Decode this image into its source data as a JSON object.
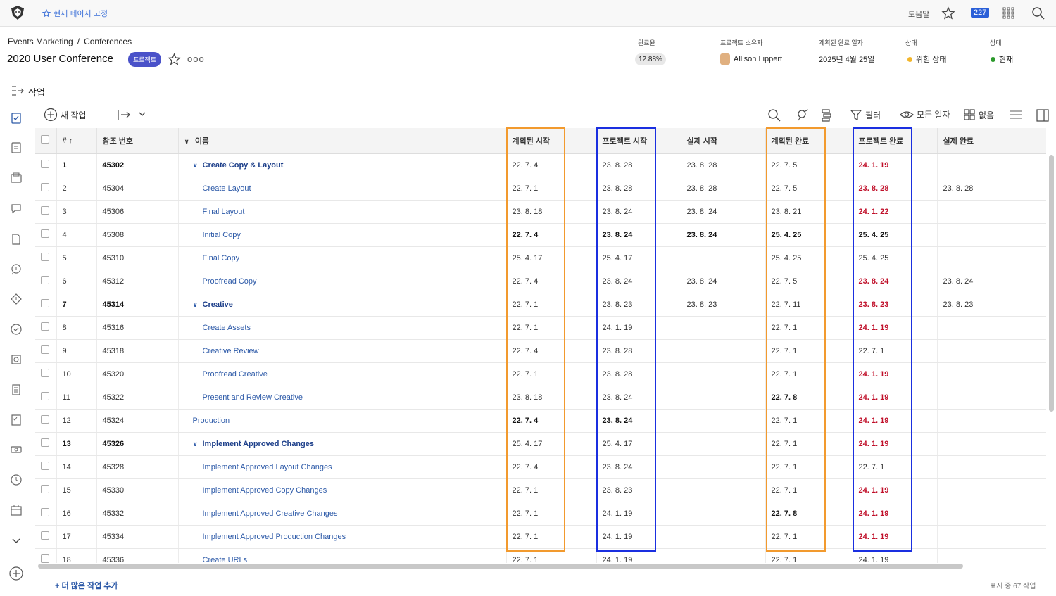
{
  "topbar": {
    "pin_label": "현재 페이지 고정",
    "help_label": "도움말",
    "notification_count": "227"
  },
  "project": {
    "breadcrumb": [
      "Events Marketing",
      "/",
      "Conferences"
    ],
    "title": "2020 User Conference",
    "tag": "프로젝트",
    "more": "ooo",
    "meta": [
      {
        "label": "완료율",
        "value": "12.88%"
      },
      {
        "label": "프로젝트 소유자",
        "value": "Allison Lippert"
      },
      {
        "label": "계획된 완료 일자",
        "value": "2025년 4월 25일"
      },
      {
        "label": "상태",
        "value": "위험 상태",
        "color": "#f3b62b"
      },
      {
        "label": "상태",
        "value": "현재",
        "color": "#2c9a2c"
      }
    ]
  },
  "section": {
    "title": "작업"
  },
  "toolbar": {
    "new_task": "새 작업",
    "filter": "필터",
    "all_dates": "모든 일자",
    "group_none": "없음"
  },
  "table": {
    "headers": {
      "num": "#",
      "ref": "참조 번호",
      "name": "이름",
      "planned_start": "계획된 시작",
      "projected_start": "프로젝트 시작",
      "actual_start": "실제 시작",
      "planned_end": "계획된 완료",
      "projected_end": "프로젝트 완료",
      "actual_end": "실제 완료"
    },
    "rows": [
      {
        "num": "1",
        "ref": "45302",
        "name": "Create Copy & Layout",
        "parent": true,
        "level": 0,
        "ps": "22. 7. 4",
        "prs": "23. 8. 28",
        "as": "23. 8. 28",
        "pe": "22. 7. 5",
        "pre": "24. 1. 19",
        "pre_red": true,
        "ae": ""
      },
      {
        "num": "2",
        "ref": "45304",
        "name": "Create Layout",
        "level": 1,
        "ps": "22. 7. 1",
        "prs": "23. 8. 28",
        "as": "23. 8. 28",
        "pe": "22. 7. 5",
        "pre": "23. 8. 28",
        "pre_red": true,
        "ae": "23. 8. 28"
      },
      {
        "num": "3",
        "ref": "45306",
        "name": "Final Layout",
        "level": 1,
        "ps": "23. 8. 18",
        "prs": "23. 8. 24",
        "as": "23. 8. 24",
        "pe": "23. 8. 21",
        "pre": "24. 1. 22",
        "pre_red": true,
        "ae": ""
      },
      {
        "num": "4",
        "ref": "45308",
        "name": "Initial Copy",
        "level": 1,
        "ps": "22. 7. 4",
        "prs": "23. 8. 24",
        "as": "23. 8. 24",
        "pe": "25. 4. 25",
        "pre": "25. 4. 25",
        "bold_dates": true,
        "ae": ""
      },
      {
        "num": "5",
        "ref": "45310",
        "name": "Final Copy",
        "level": 1,
        "ps": "25. 4. 17",
        "prs": "25. 4. 17",
        "as": "",
        "pe": "25. 4. 25",
        "pre": "25. 4. 25",
        "ae": ""
      },
      {
        "num": "6",
        "ref": "45312",
        "name": "Proofread Copy",
        "level": 1,
        "ps": "22. 7. 4",
        "prs": "23. 8. 24",
        "as": "23. 8. 24",
        "pe": "22. 7. 5",
        "pre": "23. 8. 24",
        "pre_red": true,
        "ae": "23. 8. 24"
      },
      {
        "num": "7",
        "ref": "45314",
        "name": "Creative",
        "parent": true,
        "level": 0,
        "ps": "22. 7. 1",
        "prs": "23. 8. 23",
        "as": "23. 8. 23",
        "pe": "22. 7. 11",
        "pre": "23. 8. 23",
        "pre_red": true,
        "ae": "23. 8. 23"
      },
      {
        "num": "8",
        "ref": "45316",
        "name": "Create Assets",
        "level": 1,
        "ps": "22. 7. 1",
        "prs": "24. 1. 19",
        "as": "",
        "pe": "22. 7. 1",
        "pre": "24. 1. 19",
        "pre_red": true,
        "ae": ""
      },
      {
        "num": "9",
        "ref": "45318",
        "name": "Creative Review",
        "level": 1,
        "ps": "22. 7. 4",
        "prs": "23. 8. 28",
        "as": "",
        "pe": "22. 7. 1",
        "pre": "22. 7. 1",
        "ae": ""
      },
      {
        "num": "10",
        "ref": "45320",
        "name": "Proofread Creative",
        "level": 1,
        "ps": "22. 7. 1",
        "prs": "23. 8. 28",
        "as": "",
        "pe": "22. 7. 1",
        "pre": "24. 1. 19",
        "pre_red": true,
        "ae": ""
      },
      {
        "num": "11",
        "ref": "45322",
        "name": "Present and Review Creative",
        "level": 1,
        "ps": "23. 8. 18",
        "prs": "23. 8. 24",
        "as": "",
        "pe": "22. 7. 8",
        "pe_bold": true,
        "pre": "24. 1. 19",
        "pre_red": true,
        "ae": ""
      },
      {
        "num": "12",
        "ref": "45324",
        "name": "Production",
        "level": 0,
        "ps": "22. 7. 4",
        "ps_bold": true,
        "prs": "23. 8. 24",
        "prs_bold": true,
        "as": "",
        "pe": "22. 7. 1",
        "pre": "24. 1. 19",
        "pre_red": true,
        "ae": ""
      },
      {
        "num": "13",
        "ref": "45326",
        "name": "Implement Approved Changes",
        "parent": true,
        "level": 0,
        "ps": "25. 4. 17",
        "prs": "25. 4. 17",
        "as": "",
        "pe": "22. 7. 1",
        "pre": "24. 1. 19",
        "pre_red": true,
        "ae": ""
      },
      {
        "num": "14",
        "ref": "45328",
        "name": "Implement Approved Layout Changes",
        "level": 1,
        "ps": "22. 7. 4",
        "prs": "23. 8. 24",
        "as": "",
        "pe": "22. 7. 1",
        "pre": "22. 7. 1",
        "ae": ""
      },
      {
        "num": "15",
        "ref": "45330",
        "name": "Implement Approved Copy Changes",
        "level": 1,
        "ps": "22. 7. 1",
        "prs": "23. 8. 23",
        "as": "",
        "pe": "22. 7. 1",
        "pre": "24. 1. 19",
        "pre_red": true,
        "ae": ""
      },
      {
        "num": "16",
        "ref": "45332",
        "name": "Implement Approved Creative Changes",
        "level": 1,
        "ps": "22. 7. 1",
        "prs": "24. 1. 19",
        "as": "",
        "pe": "22. 7. 8",
        "pe_bold": true,
        "pre": "24. 1. 19",
        "pre_red": true,
        "ae": ""
      },
      {
        "num": "17",
        "ref": "45334",
        "name": "Implement Approved Production Changes",
        "level": 1,
        "ps": "22. 7. 1",
        "prs": "24. 1. 19",
        "as": "",
        "pe": "22. 7. 1",
        "pre": "24. 1. 19",
        "pre_red": true,
        "ae": ""
      },
      {
        "num": "18",
        "ref": "45336",
        "name": "Create URLs",
        "level": 1,
        "ps": "22. 7. 1",
        "prs": "24. 1. 19",
        "as": "",
        "pe": "22. 7. 1",
        "pre": "24. 1. 19",
        "ae": ""
      }
    ]
  },
  "footer": {
    "add_more": "+ 더 많은 작업 추가",
    "count": "표시 중 67 작업"
  },
  "colors": {
    "accent": "#2d5aa8",
    "highlight_planned": "#f29a2e",
    "highlight_projected": "#1a2fe0",
    "late": "#c0102a"
  }
}
